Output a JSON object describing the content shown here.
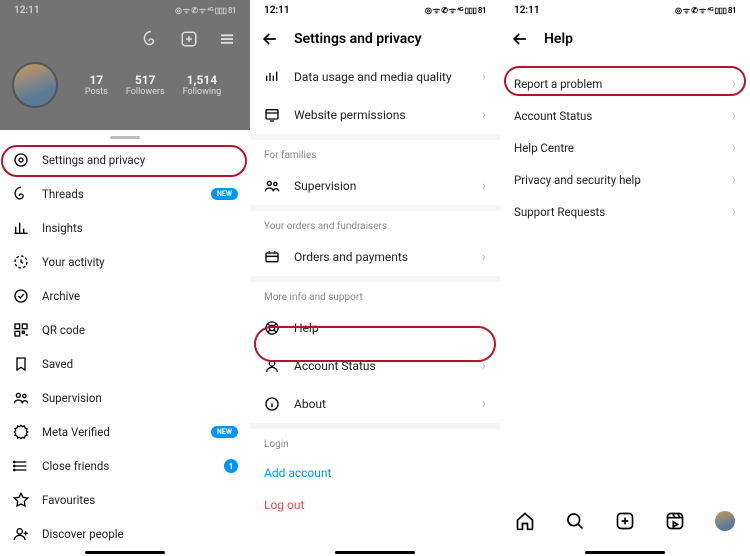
{
  "status": {
    "time": "12:11",
    "indicators": "◎ ᯤ ✆ ᯤ ⁴ᴳ ▯▯▯ 81"
  },
  "p1": {
    "stats": [
      {
        "num": "17",
        "label": "Posts"
      },
      {
        "num": "517",
        "label": "Followers"
      },
      {
        "num": "1,514",
        "label": "Following"
      }
    ],
    "menu": [
      {
        "name": "settings",
        "label": "Settings and privacy",
        "highlight": true
      },
      {
        "name": "threads",
        "label": "Threads",
        "badge": "NEW"
      },
      {
        "name": "insights",
        "label": "Insights"
      },
      {
        "name": "activity",
        "label": "Your activity"
      },
      {
        "name": "archive",
        "label": "Archive"
      },
      {
        "name": "qr",
        "label": "QR code"
      },
      {
        "name": "saved",
        "label": "Saved"
      },
      {
        "name": "supervision",
        "label": "Supervision"
      },
      {
        "name": "verified",
        "label": "Meta Verified",
        "badge": "NEW"
      },
      {
        "name": "closefriends",
        "label": "Close friends",
        "count": "1"
      },
      {
        "name": "favourites",
        "label": "Favourites"
      },
      {
        "name": "discover",
        "label": "Discover people"
      }
    ]
  },
  "p2": {
    "title": "Settings and privacy",
    "rows1": [
      {
        "name": "datausage",
        "label": "Data usage and media quality"
      },
      {
        "name": "webperm",
        "label": "Website permissions"
      }
    ],
    "section1": "For families",
    "rows2": [
      {
        "name": "supervision",
        "label": "Supervision"
      }
    ],
    "section2": "Your orders and fundraisers",
    "rows3": [
      {
        "name": "orders",
        "label": "Orders and payments"
      }
    ],
    "section3": "More info and support",
    "rows4": [
      {
        "name": "help",
        "label": "Help",
        "highlight": true
      },
      {
        "name": "accstatus",
        "label": "Account Status"
      },
      {
        "name": "about",
        "label": "About"
      }
    ],
    "section4": "Login",
    "addaccount": "Add account",
    "logout": "Log out"
  },
  "p3": {
    "title": "Help",
    "rows": [
      {
        "name": "report",
        "label": "Report a problem",
        "highlight": true
      },
      {
        "name": "accstatus",
        "label": "Account Status"
      },
      {
        "name": "helpcentre",
        "label": "Help Centre"
      },
      {
        "name": "privacyhelp",
        "label": "Privacy and security help"
      },
      {
        "name": "supportreq",
        "label": "Support Requests"
      }
    ]
  }
}
